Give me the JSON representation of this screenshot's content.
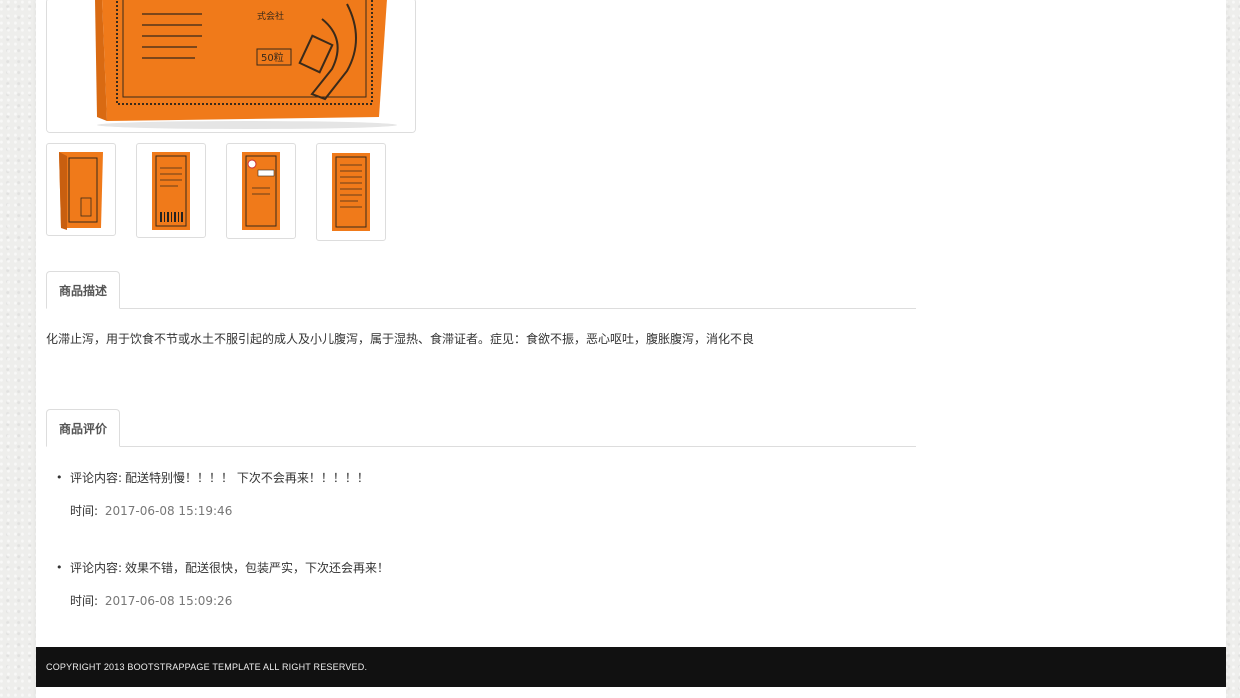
{
  "product": {
    "main_image_alt": "product-main-image",
    "box_label_text": "50粒",
    "box_side_text": "式会社",
    "thumbnail_count": 4
  },
  "tabs": {
    "description_label": "商品描述",
    "reviews_label": "商品评价"
  },
  "description": {
    "text": "化滞止泻，用于饮食不节或水土不服引起的成人及小儿腹泻，属于湿热、食滞证者。症见：食欲不振，恶心呕吐，腹胀腹泻，消化不良"
  },
  "reviews": [
    {
      "content_label": "评论内容:",
      "content": "配送特别慢！！！！ 下次不会再来！！！！！",
      "time_label": "时间:",
      "time": "2017-06-08 15:19:46"
    },
    {
      "content_label": "评论内容:",
      "content": "效果不错，配送很快，包装严实，下次还会再来！",
      "time_label": "时间:",
      "time": "2017-06-08 15:09:26"
    }
  ],
  "footer": {
    "copyright": "COPYRIGHT 2013 BOOTSTRAPPAGE TEMPLATE ALL RIGHT RESERVED."
  },
  "colors": {
    "box_orange": "#f07a1a",
    "box_dark": "#3a2a1a",
    "footer_bg": "#111111"
  }
}
